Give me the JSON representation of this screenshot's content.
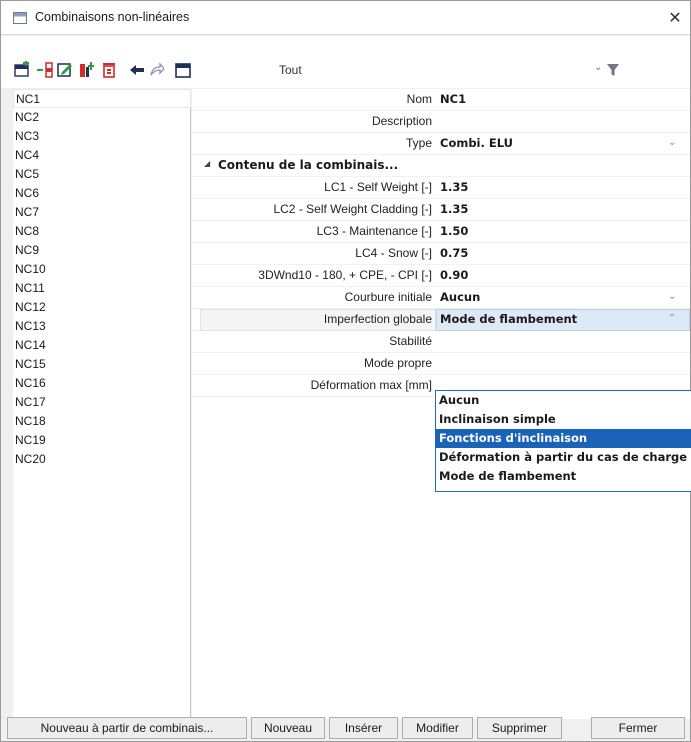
{
  "window": {
    "title": "Combinaisons non-linéaires",
    "close_glyph": "✕"
  },
  "toolbar": {
    "icons": [
      "new-icon",
      "insert-icon",
      "edit-icon",
      "copy-icon",
      "delete-icon",
      "undo-icon",
      "redo-icon",
      "table-icon"
    ],
    "filter_label": "Tout",
    "dropdown_glyph": "⌄",
    "filter_icon": "funnel-icon"
  },
  "list": {
    "selected": "NC1",
    "items": [
      "NC1",
      "NC2",
      "NC3",
      "NC4",
      "NC5",
      "NC6",
      "NC7",
      "NC8",
      "NC9",
      "NC10",
      "NC11",
      "NC12",
      "NC13",
      "NC14",
      "NC15",
      "NC16",
      "NC17",
      "NC18",
      "NC19",
      "NC20"
    ]
  },
  "properties": {
    "nom": {
      "label": "Nom",
      "value": "NC1"
    },
    "description": {
      "label": "Description",
      "value": ""
    },
    "type": {
      "label": "Type",
      "value": "Combi. ELU"
    },
    "section": {
      "label": "Contenu de la combinais..."
    },
    "coefficients": [
      {
        "label": "LC1 - Self Weight [-]",
        "value": "1.35"
      },
      {
        "label": "LC2 - Self Weight Cladding [-]",
        "value": "1.35"
      },
      {
        "label": "LC3 - Maintenance [-]",
        "value": "1.50"
      },
      {
        "label": "LC4 - Snow [-]",
        "value": "0.75"
      },
      {
        "label": "3DWnd10 - 180, + CPE, - CPI [-]",
        "value": "0.90"
      }
    ],
    "courbure": {
      "label": "Courbure initiale",
      "value": "Aucun"
    },
    "imperfection": {
      "label": "Imperfection globale",
      "value": "Mode de flambement"
    },
    "stabilite": {
      "label": "Stabilité"
    },
    "mode_propre": {
      "label": "Mode propre"
    },
    "deformation": {
      "label": "Déformation max [mm]"
    }
  },
  "dropdown": {
    "options": [
      "Aucun",
      "Inclinaison simple",
      "Fonctions d'inclinaison",
      "Déformation à partir du cas de charge",
      "Mode de flambement"
    ],
    "highlighted": "Fonctions d'inclinaison"
  },
  "buttons": {
    "new_from": "Nouveau à partir de combinais...",
    "new": "Nouveau",
    "insert": "Insérer",
    "modify": "Modifier",
    "delete": "Supprimer",
    "close": "Fermer"
  },
  "colors": {
    "selection": "#1b63b8",
    "highlight_value": "#ddeaf6",
    "icon_red": "#d42a2a",
    "icon_green": "#2f9a3e",
    "icon_navy": "#1f2f57"
  }
}
